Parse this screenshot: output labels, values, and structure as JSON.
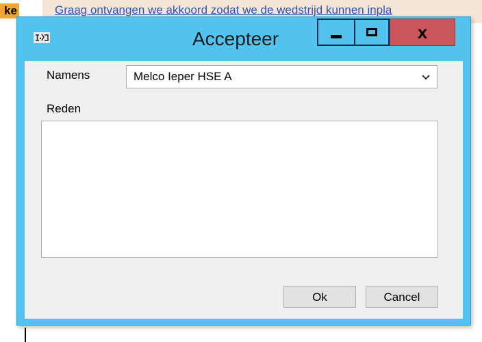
{
  "background": {
    "fragment_label": "ke",
    "notice_text": "Graag ontvangen we akkoord zodat we de wedstrijd kunnen inpla"
  },
  "window": {
    "title": "Accepteer",
    "icon": "app-icon",
    "controls": {
      "minimize_icon": "minimize-icon",
      "maximize_icon": "maximize-icon",
      "close_label": "x"
    }
  },
  "form": {
    "namens_label": "Namens",
    "namens_value": "Melco Ieper HSE A",
    "reden_label": "Reden",
    "reden_value": ""
  },
  "buttons": {
    "ok_label": "Ok",
    "cancel_label": "Cancel"
  },
  "colors": {
    "window_frame": "#52c3ef",
    "close_button": "#c9575a",
    "client_background": "#f0f0f0",
    "link_text": "#2b55b3",
    "highlight_orange": "#f3a533"
  }
}
